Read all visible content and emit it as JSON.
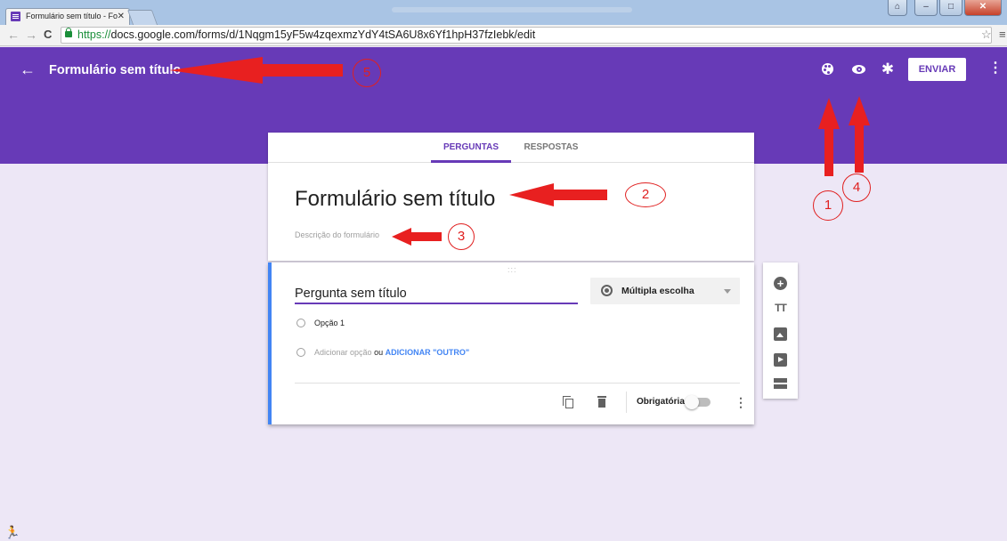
{
  "browser": {
    "tab_title": "Formulário sem título - Fo",
    "tab_close": "✕",
    "url_scheme": "https://",
    "url_rest": "docs.google.com/forms/d/1Nqgm15yF5w4zqexmzYdY4tSA6U8x6Yf1hpH37fzIebk/edit",
    "back_glyph": "←",
    "forward_glyph": "→",
    "reload_glyph": "C",
    "star_glyph": "☆",
    "menu_glyph": "≡",
    "win_user": "⌂",
    "win_minimize": "–",
    "win_maximize": "□",
    "win_close": "✕"
  },
  "header": {
    "back_glyph": "←",
    "title": "Formulário sem título",
    "gear_glyph": "✱",
    "send_label": "ENVIAR",
    "more_glyph": "⋮",
    "icons": [
      "palette-icon",
      "eye-icon",
      "gear-icon",
      "more-vert-icon"
    ],
    "color": "#673ab7"
  },
  "tabs": {
    "questions": "PERGUNTAS",
    "responses": "RESPOSTAS"
  },
  "form": {
    "title": "Formulário sem título",
    "description_placeholder": "Descrição do formulário"
  },
  "question": {
    "drag_glyph": ":::",
    "title": "Pergunta sem título",
    "type": "Múltipla escolha",
    "option1": "Opção 1",
    "add_option": "Adicionar opção",
    "or": "ou",
    "add_other": "ADICIONAR \"OUTRO\"",
    "required_label": "Obrigatória",
    "required_on": false,
    "more_glyph": "⋮"
  },
  "side_toolbar": {
    "add_glyph": "+",
    "text_glyph": "TT",
    "icons": [
      "add-question-icon",
      "title-text-icon",
      "image-icon",
      "video-icon",
      "section-icon"
    ]
  },
  "footer": {
    "runner_glyph": "🏃"
  },
  "annotations": {
    "n1": "1",
    "n2": "2",
    "n3": "3",
    "n4": "4",
    "n5": "5",
    "color": "#e02020"
  }
}
